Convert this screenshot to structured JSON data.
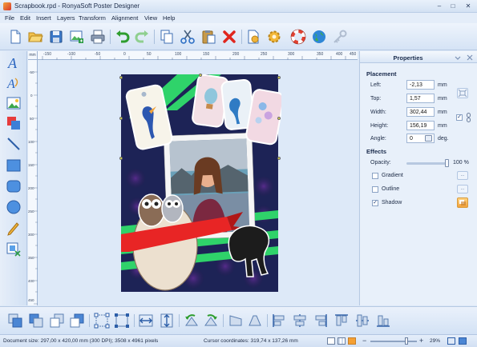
{
  "window": {
    "title": "Scrapbook.rpd - RonyaSoft Poster Designer",
    "minimize_glyph": "–",
    "maximize_glyph": "□",
    "close_glyph": "✕"
  },
  "menu": [
    "File",
    "Edit",
    "Insert",
    "Layers",
    "Transform",
    "Alignment",
    "View",
    "Help"
  ],
  "toolbar": {
    "icons": [
      "new-document-icon",
      "open-folder-icon",
      "save-icon",
      "export-image-icon",
      "print-icon",
      "undo-icon",
      "redo-icon",
      "copy-icon",
      "cut-icon",
      "paste-icon",
      "delete-icon",
      "document-settings-icon",
      "settings-gear-icon",
      "help-lifebuoy-icon",
      "website-globe-icon",
      "register-key-icon"
    ]
  },
  "left_tools": {
    "icons": [
      "text-tool-icon",
      "curved-text-tool-icon",
      "image-tool-icon",
      "clipart-tool-icon",
      "line-tool-icon",
      "rectangle-tool-icon",
      "rounded-rectangle-tool-icon",
      "ellipse-tool-icon",
      "pencil-tool-icon",
      "picture-frame-tool-icon"
    ]
  },
  "ruler": {
    "unit": "mm",
    "h_labels": [
      "-150",
      "-100",
      "-50",
      "0",
      "50",
      "100",
      "150",
      "200",
      "250",
      "300",
      "350",
      "400",
      "450"
    ],
    "v_labels": [
      "-50",
      "0",
      "50",
      "100",
      "150",
      "200",
      "250",
      "300",
      "350",
      "400",
      "450"
    ]
  },
  "properties": {
    "title": "Properties",
    "placement_title": "Placement",
    "left": {
      "label": "Left:",
      "value": "-2,13",
      "unit": "mm"
    },
    "top": {
      "label": "Top:",
      "value": "1,57",
      "unit": "mm"
    },
    "width": {
      "label": "Width:",
      "value": "302,44",
      "unit": "mm"
    },
    "height": {
      "label": "Height:",
      "value": "156,19",
      "unit": "mm"
    },
    "angle": {
      "label": "Angle:",
      "value": "0",
      "unit": "deg."
    },
    "effects_title": "Effects",
    "opacity": {
      "label": "Opacity:",
      "value": "100 %",
      "level": 1.0
    },
    "gradient": {
      "label": "Gradient",
      "checked": false
    },
    "outline": {
      "label": "Outline",
      "checked": false
    },
    "shadow": {
      "label": "Shadow",
      "checked": true
    },
    "keep_ratio_checked": true,
    "ellipsis": "..."
  },
  "bottom_tools": {
    "icons": [
      "bring-to-front-icon",
      "bring-forward-icon",
      "send-backward-icon",
      "send-to-back-icon",
      "group-icon",
      "ungroup-icon",
      "flip-horizontal-icon",
      "flip-vertical-icon",
      "rotate-left-icon",
      "rotate-right-icon",
      "skew-left-icon",
      "skew-right-icon",
      "align-left-icon",
      "align-center-icon",
      "align-right-icon",
      "align-top-icon",
      "align-middle-icon",
      "align-bottom-icon"
    ]
  },
  "status": {
    "document_size": "Document size: 297,00 x 420,00 mm (300 DPI); 3508 x 4961 pixels",
    "cursor": "Cursor coordinates: 319,74 x 137,26 mm",
    "zoom": "29%",
    "zoom_level": 0.29
  },
  "colors": {
    "accent": "#2f6fd0",
    "panel_bg": "#e8f0fa",
    "canvas_green": "#2fd36a",
    "banner_red": "#e82525"
  }
}
